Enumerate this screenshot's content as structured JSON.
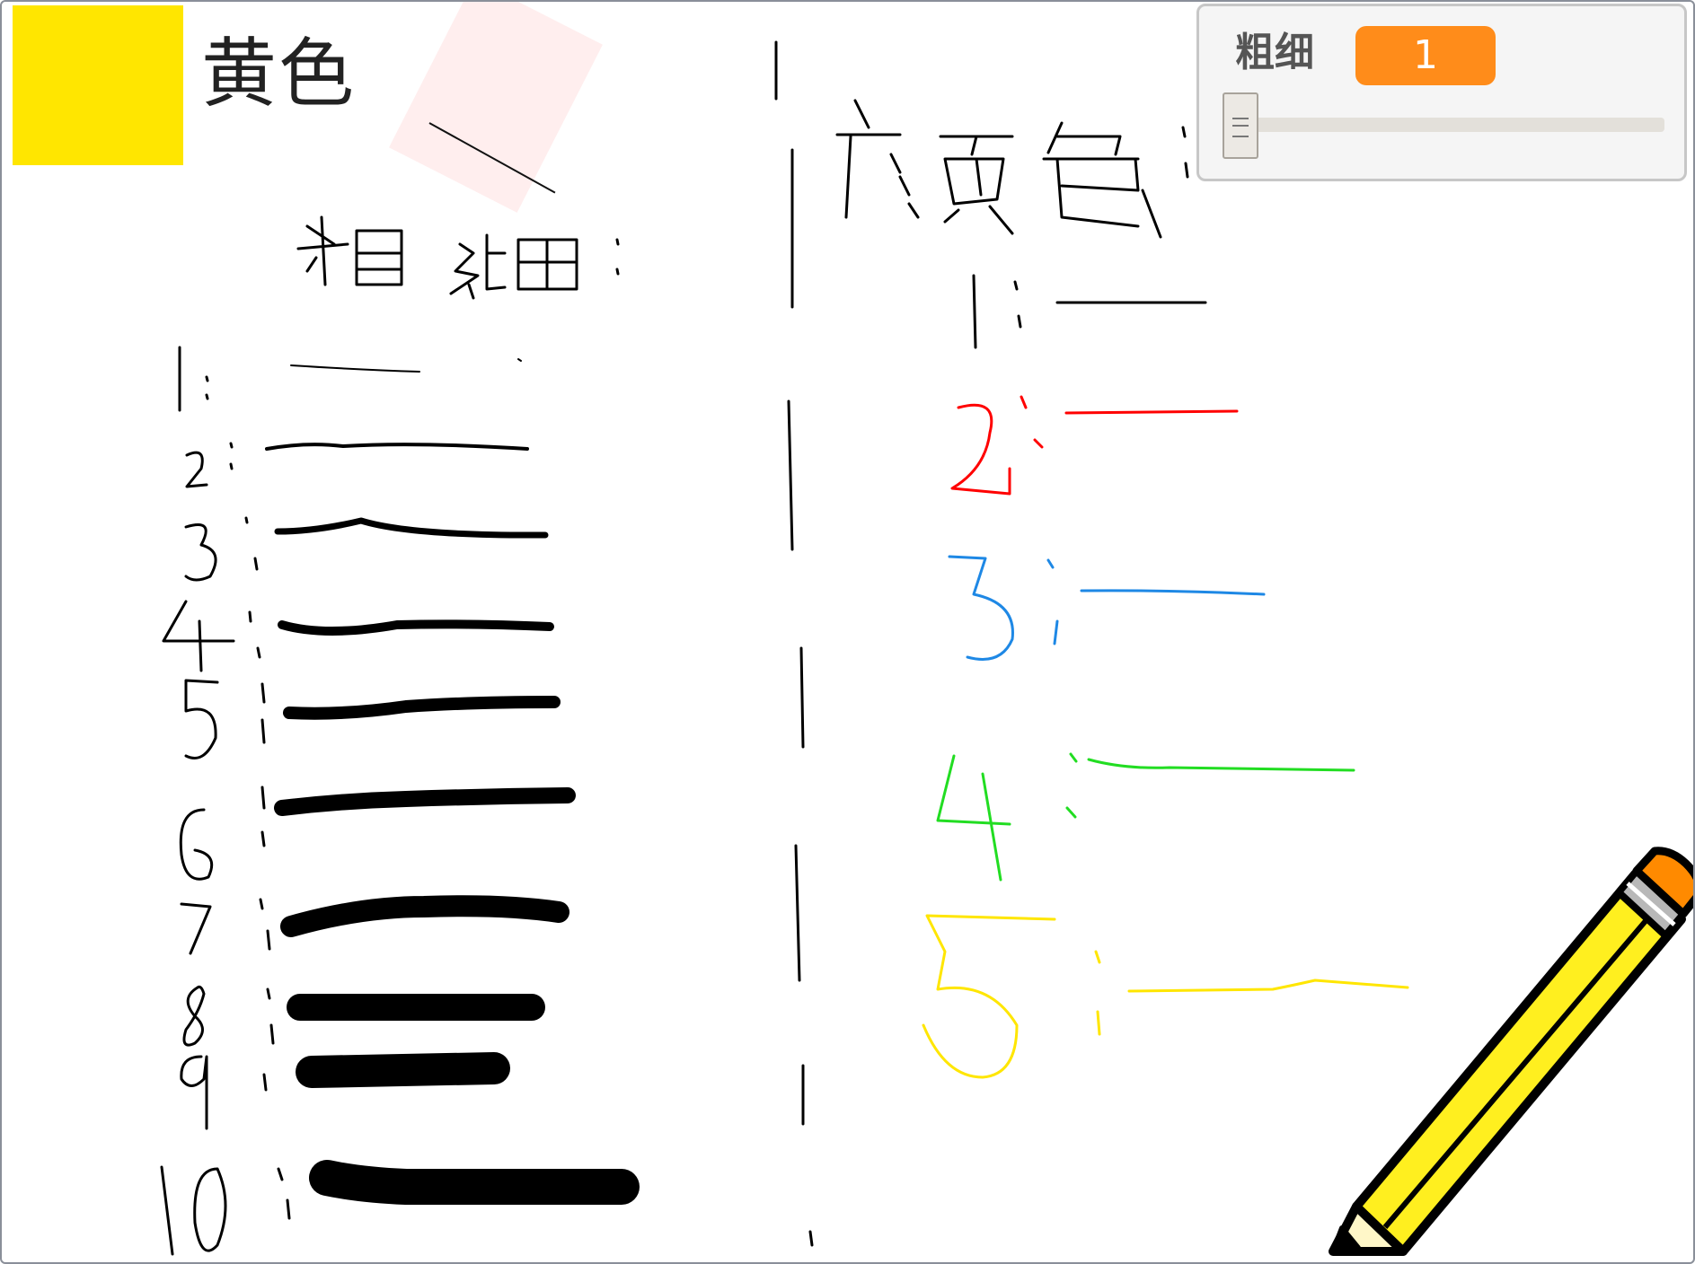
{
  "stage": {
    "background": "#ffffff"
  },
  "color_sprite": {
    "label": "黄色",
    "swatch_color": "#ffe600"
  },
  "variable_monitor": {
    "label": "粗细",
    "value": "1",
    "value_color": "#ff8c1a",
    "slider_position": 0
  },
  "drawing": {
    "ink_colors": [
      "#000000",
      "#ff0000",
      "#1e88e5",
      "#22dd22",
      "#ffe600"
    ],
    "thickness_rows": [
      1,
      2,
      3,
      4,
      5,
      6,
      7,
      8,
      9,
      10
    ],
    "color_rows": [
      1,
      2,
      3,
      4,
      5
    ]
  },
  "icons": {
    "pencil": "pencil-icon",
    "eraser": "eraser-icon"
  }
}
